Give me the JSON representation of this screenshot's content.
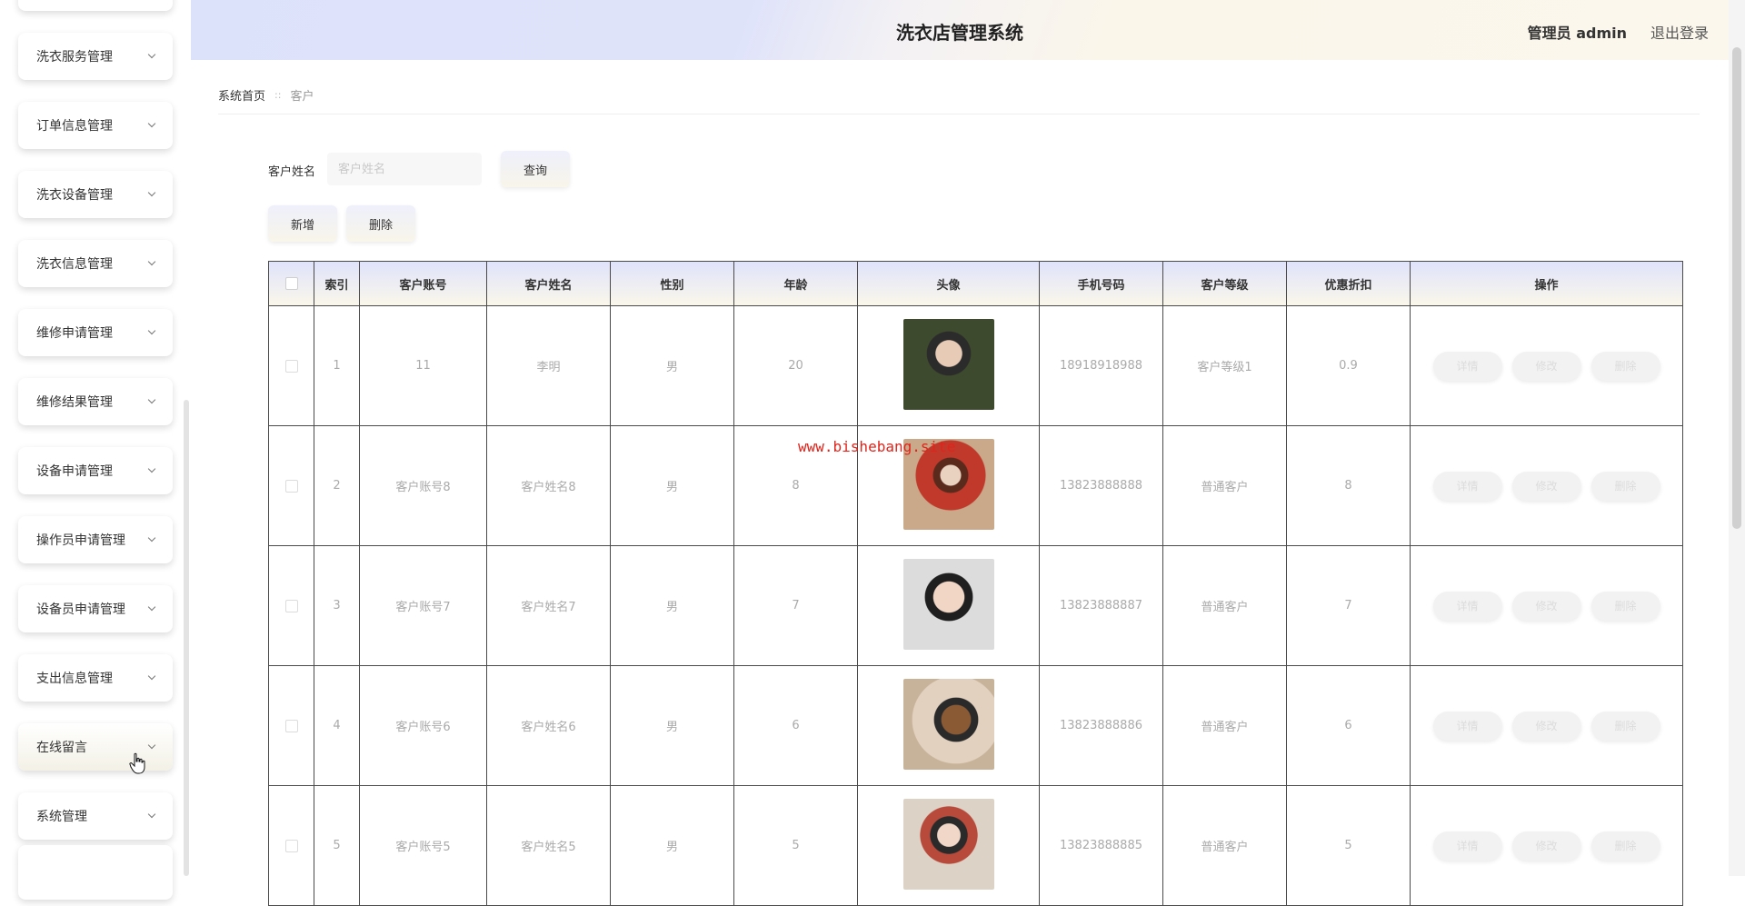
{
  "sidebar": {
    "items": [
      {
        "label": "洗衣服务管理"
      },
      {
        "label": "订单信息管理"
      },
      {
        "label": "洗衣设备管理"
      },
      {
        "label": "洗衣信息管理"
      },
      {
        "label": "维修申请管理"
      },
      {
        "label": "维修结果管理"
      },
      {
        "label": "设备申请管理"
      },
      {
        "label": "操作员申请管理"
      },
      {
        "label": "设备员申请管理"
      },
      {
        "label": "支出信息管理"
      },
      {
        "label": "在线留言"
      },
      {
        "label": "系统管理"
      }
    ],
    "active_item": "在线留言"
  },
  "header": {
    "title": "洗衣店管理系统",
    "admin_label": "管理员 admin",
    "logout_label": "退出登录"
  },
  "breadcrumb": {
    "home": "系统首页",
    "current": "客户"
  },
  "search": {
    "label": "客户姓名",
    "placeholder": "客户姓名",
    "button_label": "查询"
  },
  "actions": {
    "add_label": "新增",
    "delete_label": "删除"
  },
  "table": {
    "headers": [
      "索引",
      "客户账号",
      "客户姓名",
      "性别",
      "年龄",
      "头像",
      "手机号码",
      "客户等级",
      "优惠折扣",
      "操作"
    ],
    "rows": [
      {
        "index": "1",
        "account": "11",
        "name": "李明",
        "gender": "男",
        "age": "20",
        "phone": "18918918988",
        "level": "客户等级1",
        "discount": "0.9"
      },
      {
        "index": "2",
        "account": "客户账号8",
        "name": "客户姓名8",
        "gender": "男",
        "age": "8",
        "phone": "13823888888",
        "level": "普通客户",
        "discount": "8"
      },
      {
        "index": "3",
        "account": "客户账号7",
        "name": "客户姓名7",
        "gender": "男",
        "age": "7",
        "phone": "13823888887",
        "level": "普通客户",
        "discount": "7"
      },
      {
        "index": "4",
        "account": "客户账号6",
        "name": "客户姓名6",
        "gender": "男",
        "age": "6",
        "phone": "13823888886",
        "level": "普通客户",
        "discount": "6"
      },
      {
        "index": "5",
        "account": "客户账号5",
        "name": "客户姓名5",
        "gender": "男",
        "age": "5",
        "phone": "13823888885",
        "level": "普通客户",
        "discount": "5"
      }
    ],
    "row_actions": {
      "detail": "详情",
      "edit": "修改",
      "delete": "删除"
    }
  },
  "watermark": "www.bishebang.site"
}
